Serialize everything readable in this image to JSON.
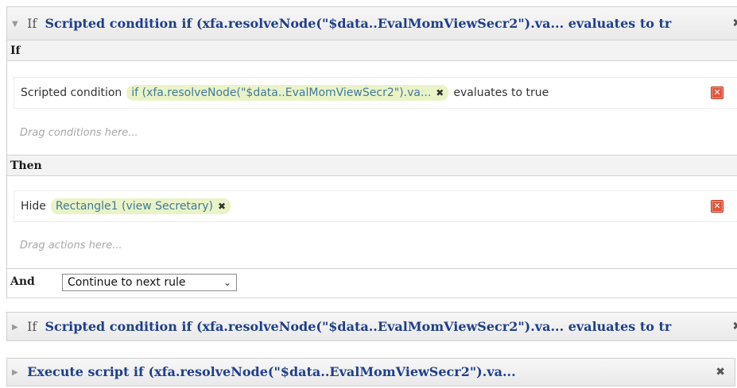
{
  "rules": [
    {
      "expanded": true,
      "prefix": "If",
      "title": "Scripted condition if (xfa.resolveNode(\"$data..EvalMomViewSecr2\").va... evaluates to tr",
      "close_glyph": "✖",
      "if_section": {
        "label": "If",
        "condition": {
          "text_before": "Scripted condition",
          "chip_label": "if (xfa.resolveNode(\"$data..EvalMomViewSecr2\").va...",
          "text_after": "evaluates to true"
        },
        "drag_hint": "Drag conditions here..."
      },
      "then_section": {
        "label": "Then",
        "action": {
          "text_before": "Hide",
          "chip_label": "Rectangle1 (view Secretary)"
        },
        "drag_hint": "Drag actions here..."
      },
      "and_section": {
        "label": "And",
        "selected_option": "Continue to next rule"
      }
    },
    {
      "expanded": false,
      "prefix": "If",
      "title": "Scripted condition if (xfa.resolveNode(\"$data..EvalMomViewSecr2\").va... evaluates to tr",
      "close_glyph": "✖"
    },
    {
      "expanded": false,
      "prefix": "",
      "title": "Execute script if (xfa.resolveNode(\"$data..EvalMomViewSecr2\").va...",
      "close_glyph": "✖"
    }
  ],
  "icons": {
    "collapse": "triangle-down-icon",
    "expand": "triangle-right-icon",
    "remove_chip": "x-icon",
    "delete": "red-delete-icon",
    "dropdown": "chevron-down-icon"
  },
  "colors": {
    "title_blue": "#1e3f8a",
    "chip_bg": "#eaf3c7",
    "chip_text": "#3f7a9a",
    "delete_red": "#e2553d"
  }
}
